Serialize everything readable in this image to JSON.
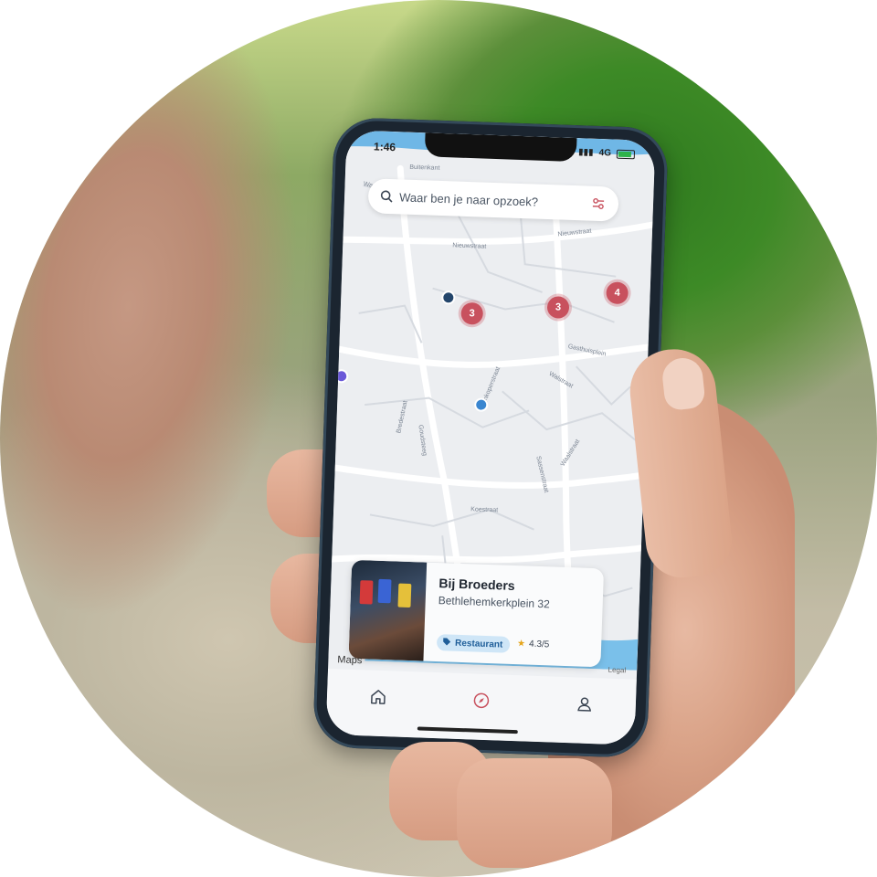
{
  "status_bar": {
    "time": "1:46",
    "network": "4G"
  },
  "search": {
    "placeholder": "Waar ben je naar opzoek?"
  },
  "map": {
    "streets": [
      "Buitenkant",
      "Water",
      "Nieuwstraat",
      "Nieuwstraat",
      "Gasthuisplein",
      "Walstraat",
      "Koestraat",
      "Goudsteeg",
      "Bredestraat",
      "Sassenstraat",
      "Wijnkoperstraat",
      "Waalstraat"
    ],
    "clusters": [
      {
        "count": "3"
      },
      {
        "count": "3"
      },
      {
        "count": "4"
      }
    ]
  },
  "place_card": {
    "title": "Bij Broeders",
    "address": "Bethlehemkerkplein 32",
    "category": "Restaurant",
    "rating": "4.3/5"
  },
  "attribution": {
    "maps": "Maps",
    "legal": "Legal"
  },
  "tabs": [
    {
      "name": "home"
    },
    {
      "name": "explore"
    },
    {
      "name": "profile"
    }
  ],
  "colors": {
    "accent": "#c8515e",
    "tag_bg": "#cfe6f7",
    "tag_text": "#1f5e99"
  }
}
